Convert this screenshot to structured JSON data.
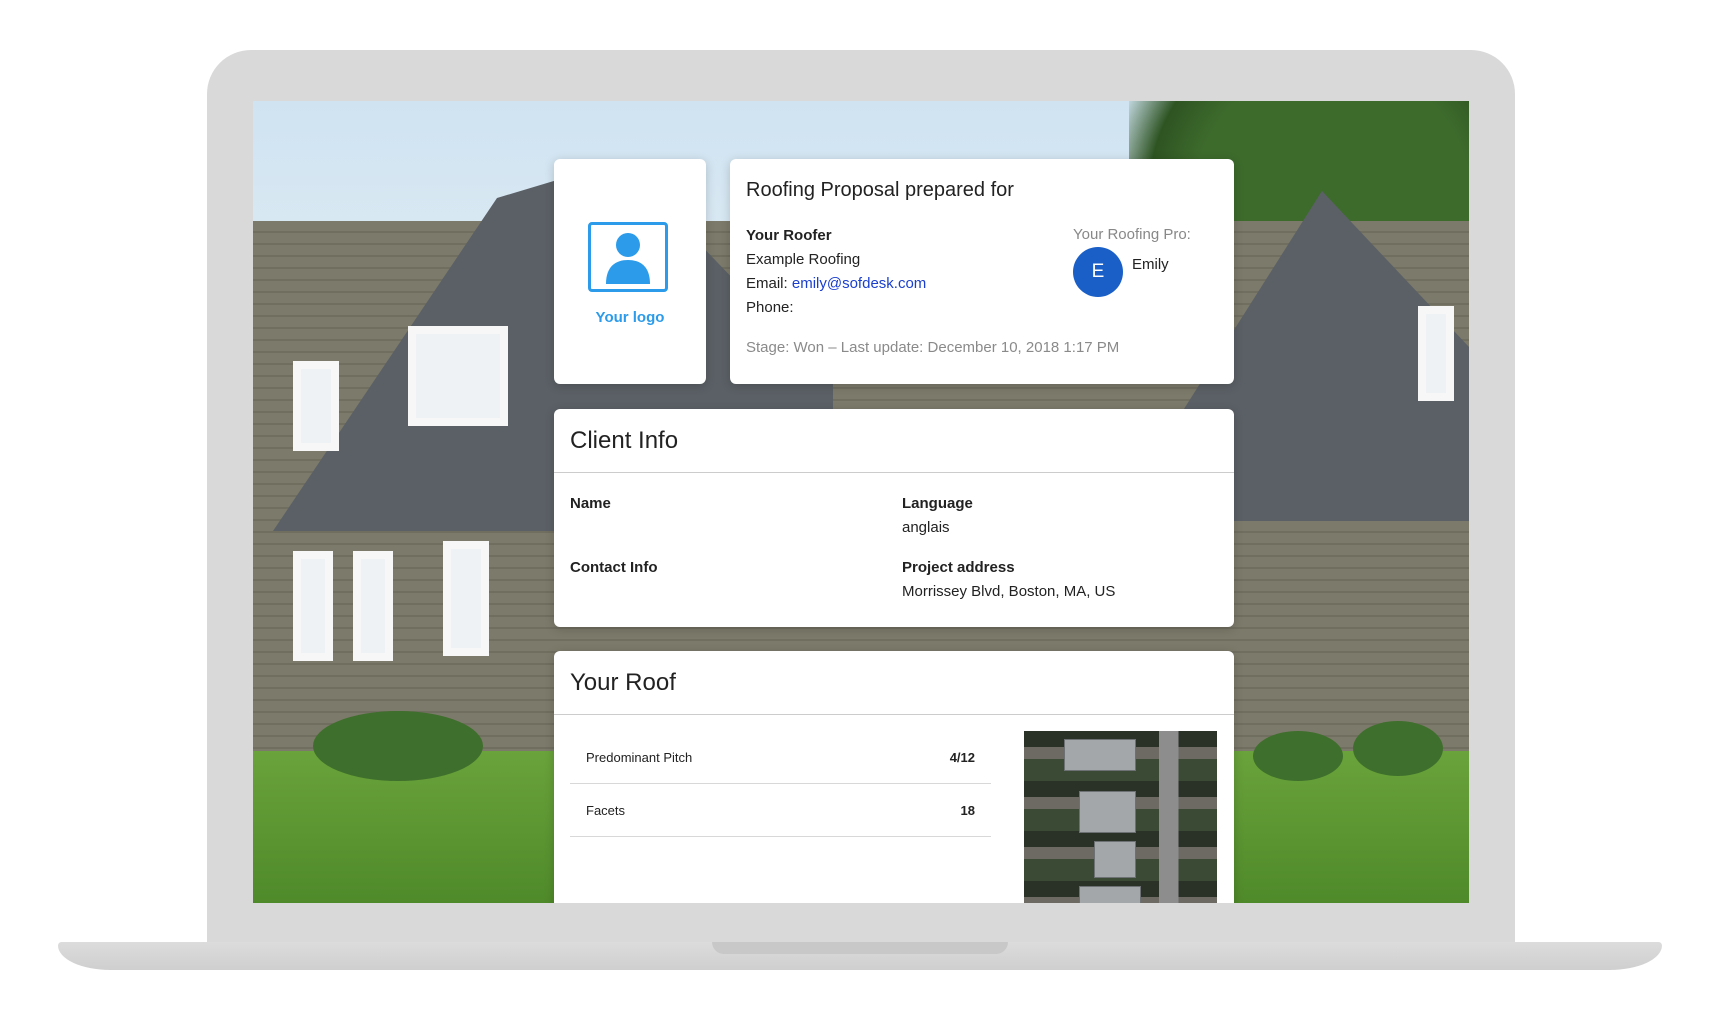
{
  "logo_card": {
    "label": "Your logo"
  },
  "proposal": {
    "title": "Roofing Proposal prepared for",
    "roofer_heading": "Your Roofer",
    "company": "Example Roofing",
    "email_label": "Email:",
    "email": "emily@sofdesk.com",
    "phone_label": "Phone:",
    "pro_label": "Your Roofing Pro:",
    "pro_initial": "E",
    "pro_name": "Emily",
    "stage": "Stage: Won – Last update: December 10, 2018 1:17 PM"
  },
  "client_info": {
    "title": "Client Info",
    "name_label": "Name",
    "language_label": "Language",
    "language_value": "anglais",
    "contact_label": "Contact Info",
    "address_label": "Project address",
    "address_value": "Morrissey Blvd, Boston, MA, US"
  },
  "your_roof": {
    "title": "Your Roof",
    "rows": [
      {
        "label": "Predominant Pitch",
        "value": "4/12"
      },
      {
        "label": "Facets",
        "value": "18"
      }
    ]
  },
  "colors": {
    "accent": "#2b9bea",
    "avatar": "#1a5fc7",
    "link": "#1a3fcf"
  }
}
